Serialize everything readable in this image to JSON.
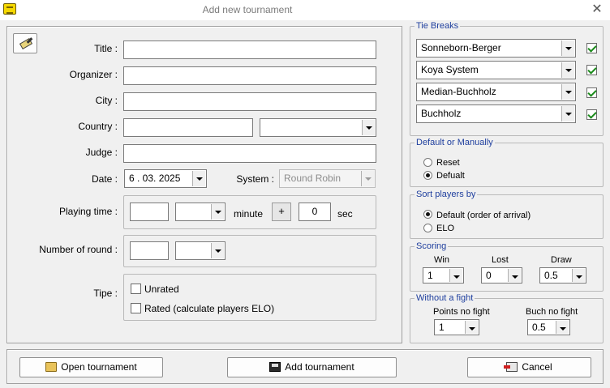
{
  "window": {
    "title": "Add new tournament"
  },
  "form": {
    "title_label": "Title :",
    "title_value": "",
    "organizer_label": "Organizer :",
    "organizer_value": "",
    "city_label": "City :",
    "city_value": "",
    "country_label": "Country :",
    "country_value": "",
    "country_select": "",
    "judge_label": "Judge :",
    "judge_value": "",
    "date_label": "Date :",
    "date_value": "6 . 03. 2025",
    "system_label": "System :",
    "system_value": "Round Robin",
    "playing_time_label": "Playing time :",
    "playing_time_value": "",
    "playing_time_select": "",
    "minute_label": "minute",
    "plus_label": "+",
    "increment_value": "0",
    "sec_label": "sec",
    "rounds_label": "Number of round :",
    "rounds_value": "",
    "rounds_select": "",
    "tipe_label": "Tipe :",
    "tipe_options": [
      {
        "label": "Unrated",
        "checked": false
      },
      {
        "label": "Rated (calculate players ELO)",
        "checked": false
      }
    ]
  },
  "tie_breaks": {
    "legend": "Tie Breaks",
    "items": [
      {
        "value": "Sonneborn-Berger",
        "checked": true
      },
      {
        "value": "Koya System",
        "checked": true
      },
      {
        "value": "Median-Buchholz",
        "checked": true
      },
      {
        "value": "Buchholz",
        "checked": true
      }
    ]
  },
  "default_manual": {
    "legend": "Default or Manually",
    "options": [
      {
        "label": "Reset",
        "selected": false
      },
      {
        "label": "Defualt",
        "selected": true
      }
    ]
  },
  "sort_players": {
    "legend": "Sort players by",
    "options": [
      {
        "label": "Default (order of arrival)",
        "selected": true
      },
      {
        "label": "ELO",
        "selected": false
      }
    ]
  },
  "scoring": {
    "legend": "Scoring",
    "win_label": "Win",
    "win_value": "1",
    "lost_label": "Lost",
    "lost_value": "0",
    "draw_label": "Draw",
    "draw_value": "0.5"
  },
  "without_fight": {
    "legend": "Without a fight",
    "points_label": "Points no fight",
    "points_value": "1",
    "buch_label": "Buch no fight",
    "buch_value": "0.5"
  },
  "buttons": {
    "open_label": "Open tournament",
    "add_label": "Add tournament",
    "cancel_label": "Cancel"
  },
  "icons": {
    "app": "app-logo-icon",
    "close": "close-icon",
    "clear": "brush-icon",
    "open": "folder-open-icon",
    "add": "floppy-disk-icon",
    "cancel": "exit-door-icon"
  },
  "colors": {
    "legend_text": "#1f3f9e",
    "check_mark": "#1a8a1a",
    "window_bg": "#f0f0f0"
  }
}
